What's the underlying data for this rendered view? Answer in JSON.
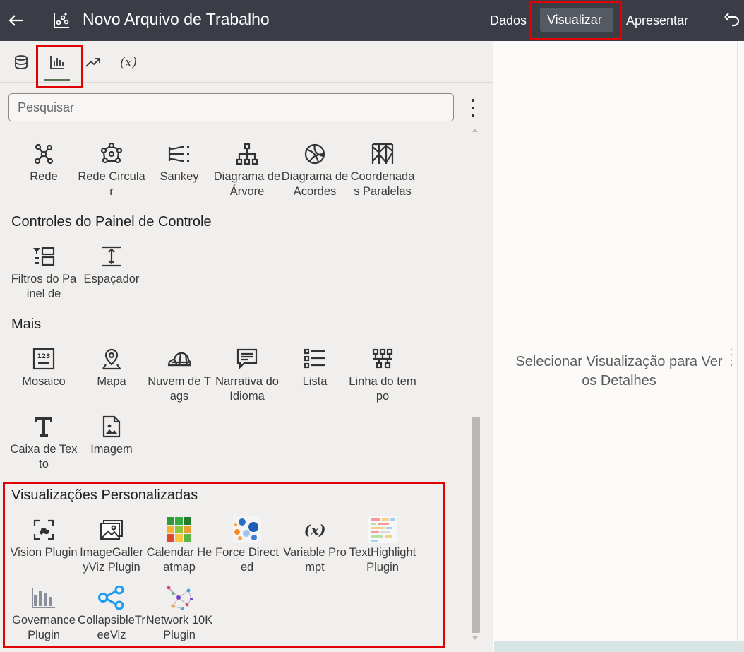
{
  "header": {
    "title": "Novo Arquivo de Trabalho",
    "nav": {
      "data": "Dados",
      "visualize": "Visualizar",
      "present": "Apresentar"
    }
  },
  "search": {
    "placeholder": "Pesquisar"
  },
  "sections": {
    "network": {
      "items": [
        {
          "label": "Rede",
          "icon": "network-icon"
        },
        {
          "label": "Rede Circular",
          "icon": "circular-network-icon"
        },
        {
          "label": "Sankey",
          "icon": "sankey-icon"
        },
        {
          "label": "Diagrama de Árvore",
          "icon": "tree-diagram-icon"
        },
        {
          "label": "Diagrama de Acordes",
          "icon": "chord-diagram-icon"
        },
        {
          "label": "Coordenadas Paralelas",
          "icon": "parallel-coordinates-icon"
        }
      ]
    },
    "dashboard_controls": {
      "title": "Controles do Painel de Controle",
      "items": [
        {
          "label": "Filtros do Painel de",
          "icon": "dashboard-filters-icon"
        },
        {
          "label": "Espaçador",
          "icon": "spacer-icon"
        }
      ]
    },
    "more": {
      "title": "Mais",
      "items": [
        {
          "label": "Mosaico",
          "icon": "tile-icon"
        },
        {
          "label": "Mapa",
          "icon": "map-pin-icon"
        },
        {
          "label": "Nuvem de Tags",
          "icon": "tag-cloud-icon"
        },
        {
          "label": "Narrativa do Idioma",
          "icon": "language-narrative-icon"
        },
        {
          "label": "Lista",
          "icon": "list-icon"
        },
        {
          "label": "Linha do tempo",
          "icon": "timeline-icon"
        },
        {
          "label": "Caixa de Texto",
          "icon": "text-box-icon"
        },
        {
          "label": "Imagem",
          "icon": "image-icon"
        }
      ]
    },
    "custom": {
      "title": "Visualizações Personalizadas",
      "items": [
        {
          "label": "Vision Plugin",
          "icon": "vision-plugin-icon"
        },
        {
          "label": "ImageGalleryViz Plugin",
          "icon": "image-gallery-icon"
        },
        {
          "label": "Calendar Heatmap",
          "icon": "calendar-heatmap-icon"
        },
        {
          "label": "Force Directed",
          "icon": "force-directed-icon"
        },
        {
          "label": "Variable Prompt",
          "icon": "variable-prompt-icon"
        },
        {
          "label": "TextHighlight Plugin",
          "icon": "text-highlight-icon"
        },
        {
          "label": "Governance Plugin",
          "icon": "governance-plugin-icon"
        },
        {
          "label": "CollapsibleTreeViz",
          "icon": "collapsible-tree-icon"
        },
        {
          "label": "Network 10K Plugin",
          "icon": "network-10k-icon"
        }
      ]
    }
  },
  "right_panel": {
    "message": "Selecionar Visualização para Ver os Detalhes"
  },
  "colors": {
    "header_bg": "#3a3d45",
    "panel_bg": "#f1efed",
    "highlight": "#e00000",
    "tab_underline": "#55744b"
  }
}
